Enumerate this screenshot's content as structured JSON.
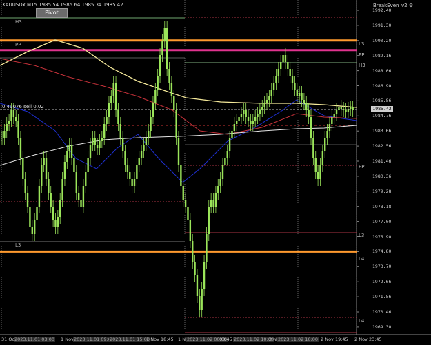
{
  "header": {
    "symbol_info": "XAUUSDx,M15  1985.54 1985.64 1985.34 1985.42",
    "indicator": "BreakEven_v2"
  },
  "pivot_button": {
    "label": "Pivot"
  },
  "trade_label": "0.40076 sell 0.02",
  "current_price": "1985.42",
  "colors": {
    "candle": "#9BE55A",
    "orange_level": "#FF9A2E",
    "magenta_level": "#E0338E",
    "pivot_grey": "#9A9A9A",
    "ma_yellow": "#F5E99A",
    "ma_blue": "#1E2FD0",
    "ma_red": "#C8323A",
    "ma_white": "#E6E6E6"
  },
  "price_axis": [
    "1992.40",
    "1991.30",
    "1990.20",
    "1989.16",
    "1988.06",
    "1986.90",
    "1985.86",
    "1984.76",
    "1983.66",
    "1982.56",
    "1981.46",
    "1980.36",
    "1979.28",
    "1978.18",
    "1977.00",
    "1975.90",
    "1974.80",
    "1973.70",
    "1972.66",
    "1971.56",
    "1970.46",
    "1969.30"
  ],
  "time_axis": [
    {
      "label": "31 Oct",
      "hl": false
    },
    {
      "label": "2023.11.01 03:00",
      "hl": true
    },
    {
      "label": "1 Nov",
      "hl": false
    },
    {
      "label": "2023.11.01 09:00",
      "hl": true
    },
    {
      "label": "2023.11.01 15:00",
      "hl": true
    },
    {
      "label": "1 Nov 18:45",
      "hl": false
    },
    {
      "label": "1 N",
      "hl": false
    },
    {
      "label": "2023.11.02 00:00",
      "hl": true
    },
    {
      "label": "03:45",
      "hl": false
    },
    {
      "label": "2023.11.02 10:00",
      "hl": true
    },
    {
      "label": "2 Nov",
      "hl": false
    },
    {
      "label": "2023.11.02 16:00",
      "hl": true
    },
    {
      "label": "2 Nov 19:45",
      "hl": false
    },
    {
      "label": "2 Nov 23:45",
      "hl": false
    }
  ],
  "levels_left": {
    "h3": "H3",
    "pp": "PP",
    "l3": "L3"
  },
  "levels_right": {
    "l3_top": "L3",
    "pp_top": "PP",
    "h3": "H3",
    "pp": "PP",
    "l3": "L3",
    "l4": "L4",
    "l4_low": "L4"
  },
  "chart_data": {
    "type": "candlestick",
    "symbol": "XAUUSDx",
    "timeframe": "M15",
    "ylim": [
      1969.3,
      1992.9
    ],
    "horizontal_levels": [
      {
        "price": 1990.2,
        "color": "orange"
      },
      {
        "price": 1989.5,
        "color": "magenta"
      },
      {
        "price": 1974.8,
        "color": "orange"
      }
    ],
    "last_price": 1985.42
  }
}
